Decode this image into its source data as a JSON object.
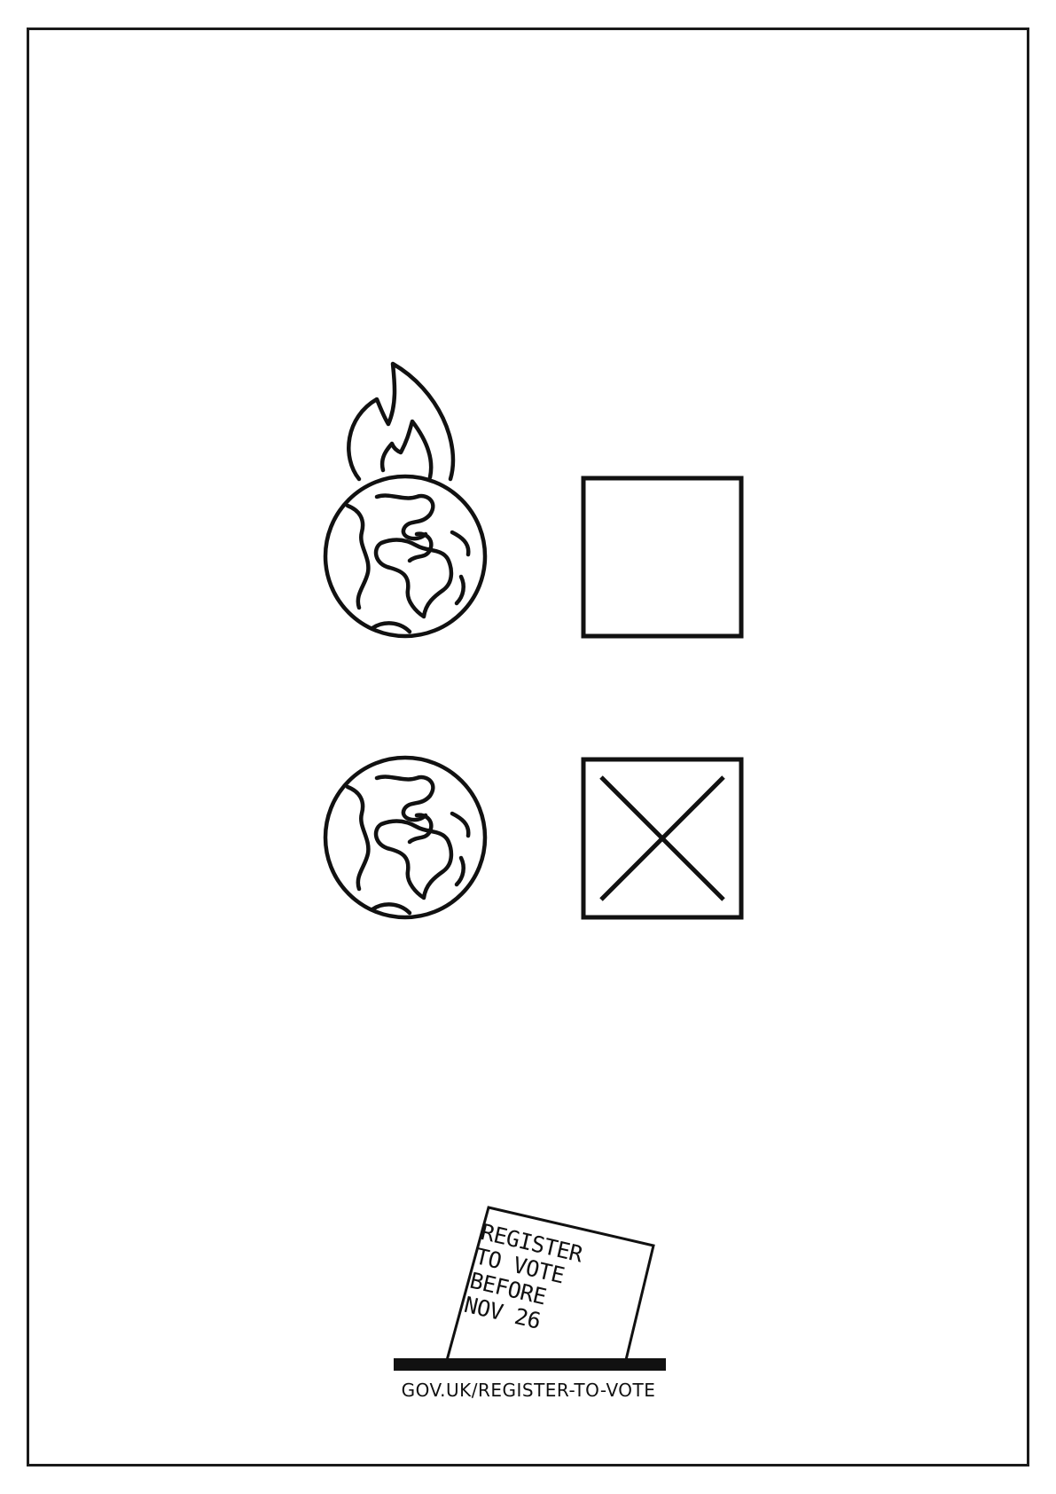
{
  "poster": {
    "options": [
      {
        "icon": "burning-earth-icon",
        "checkbox_state": "unchecked"
      },
      {
        "icon": "earth-icon",
        "checkbox_state": "checked-x"
      }
    ],
    "ballot_paper": {
      "line1": "REGISTER",
      "line2": "TO VOTE",
      "line3": "BEFORE",
      "line4": "NOV 26"
    },
    "url": "GOV.UK/REGISTER-TO-VOTE"
  },
  "colors": {
    "ink": "#111111",
    "background": "#ffffff"
  }
}
